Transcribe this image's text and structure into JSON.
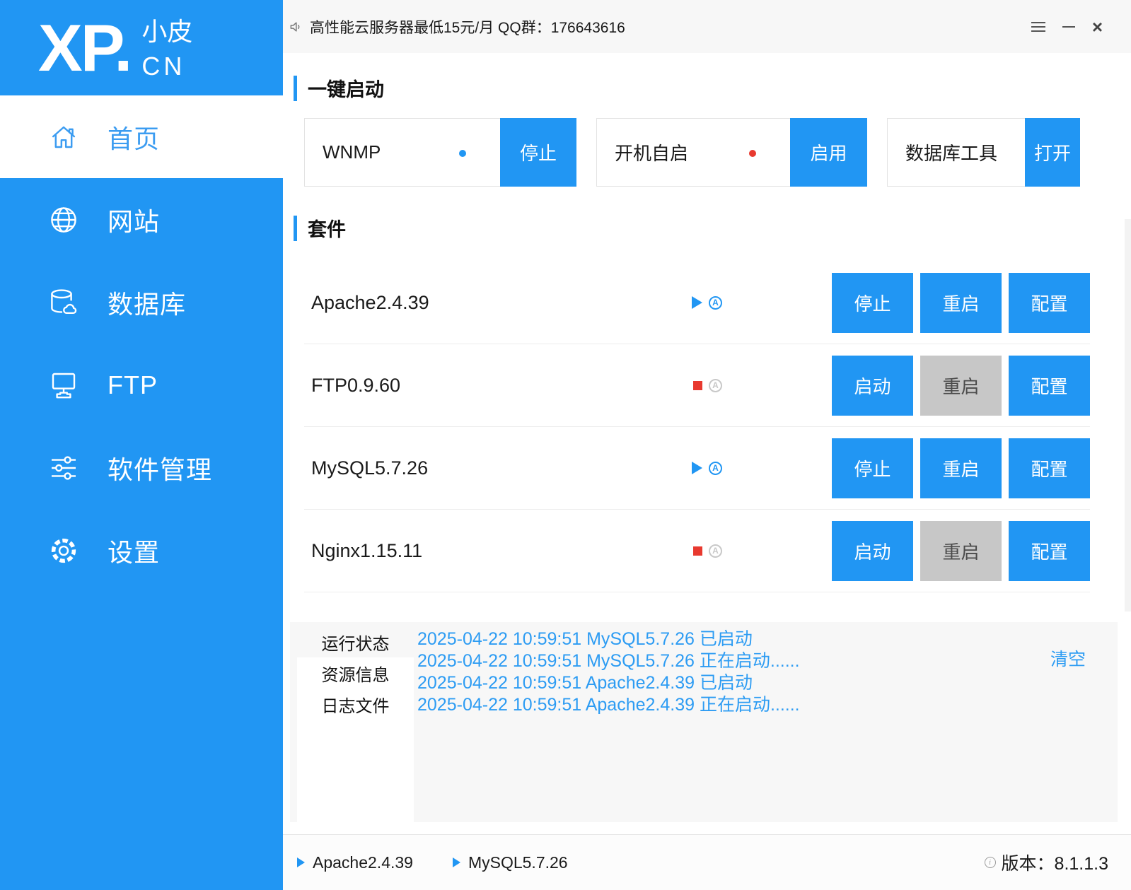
{
  "colors": {
    "primary_blue": "#2196F3",
    "active_menu_text": "#3B9CF1",
    "log_text_blue": "#2D9CF3",
    "running_blue": "#2196F3",
    "stopped_red": "#E8392F",
    "disabled_button_gray": "#C7C7C7",
    "topbar_bg": "#F7F7F7",
    "log_panel_bg": "#F7F7F7"
  },
  "sidebar": {
    "logo": {
      "main": "XP.",
      "sub_top": "小皮",
      "sub_bottom": "CN"
    },
    "items": [
      {
        "label": "首页",
        "icon": "home-icon",
        "active": true
      },
      {
        "label": "网站",
        "icon": "globe-icon",
        "active": false
      },
      {
        "label": "数据库",
        "icon": "database-icon",
        "active": false
      },
      {
        "label": "FTP",
        "icon": "ftp-network-icon",
        "active": false
      },
      {
        "label": "软件管理",
        "icon": "sliders-icon",
        "active": false
      },
      {
        "label": "设置",
        "icon": "gear-icon",
        "active": false
      }
    ]
  },
  "topbar": {
    "announcement": "高性能云服务器最低15元/月  QQ群：176643616",
    "controls": {
      "menu": "≡",
      "minimize": "−",
      "close": "×"
    }
  },
  "quick_start": {
    "title": "一键启动",
    "panels": [
      {
        "label": "WNMP",
        "status": "running",
        "button": "停止"
      },
      {
        "label": "开机自启",
        "status": "off",
        "button": "启用"
      },
      {
        "label": "数据库工具",
        "status": null,
        "button": "打开"
      }
    ]
  },
  "suites": {
    "title": "套件",
    "rows": [
      {
        "name": "Apache2.4.39",
        "status": "running",
        "buttons": [
          {
            "label": "停止",
            "disabled": false
          },
          {
            "label": "重启",
            "disabled": false
          },
          {
            "label": "配置",
            "disabled": false
          }
        ]
      },
      {
        "name": "FTP0.9.60",
        "status": "stopped",
        "buttons": [
          {
            "label": "启动",
            "disabled": false
          },
          {
            "label": "重启",
            "disabled": true
          },
          {
            "label": "配置",
            "disabled": false
          }
        ]
      },
      {
        "name": "MySQL5.7.26",
        "status": "running",
        "buttons": [
          {
            "label": "停止",
            "disabled": false
          },
          {
            "label": "重启",
            "disabled": false
          },
          {
            "label": "配置",
            "disabled": false
          }
        ]
      },
      {
        "name": "Nginx1.15.11",
        "status": "stopped",
        "buttons": [
          {
            "label": "启动",
            "disabled": false
          },
          {
            "label": "重启",
            "disabled": true
          },
          {
            "label": "配置",
            "disabled": false
          }
        ]
      }
    ]
  },
  "log_panel": {
    "tabs": [
      "运行状态",
      "资源信息",
      "日志文件"
    ],
    "active_tab": "运行状态",
    "clear_label": "清空",
    "lines": [
      "2025-04-22 10:59:51 MySQL5.7.26 已启动",
      "2025-04-22 10:59:51 MySQL5.7.26 正在启动......",
      "2025-04-22 10:59:51 Apache2.4.39 已启动",
      "2025-04-22 10:59:51 Apache2.4.39 正在启动......"
    ]
  },
  "footer": {
    "services": [
      "Apache2.4.39",
      "MySQL5.7.26"
    ],
    "version_label": "版本：8.1.1.3"
  },
  "icons": {
    "autostart_letter": "A"
  }
}
